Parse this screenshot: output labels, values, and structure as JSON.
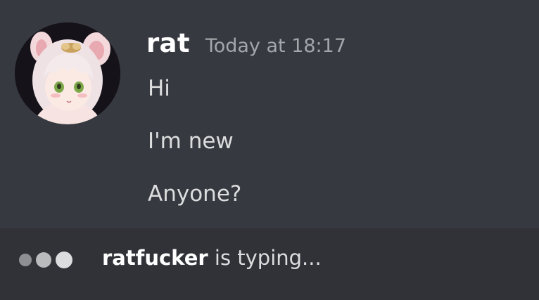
{
  "message": {
    "username": "rat",
    "timestamp": "Today at 18:17",
    "lines": [
      "Hi",
      "I'm new",
      "Anyone?"
    ]
  },
  "typing": {
    "user": "ratfucker",
    "suffix": " is typing..."
  },
  "colors": {
    "background": "#36393f",
    "typing_bar": "#303237",
    "username": "#ffffff",
    "timestamp": "#a3a6aa",
    "message_text": "#dcddde"
  },
  "icons": {
    "avatar": "anime-girl-avatar",
    "typing_indicator": "typing-dots-icon"
  }
}
